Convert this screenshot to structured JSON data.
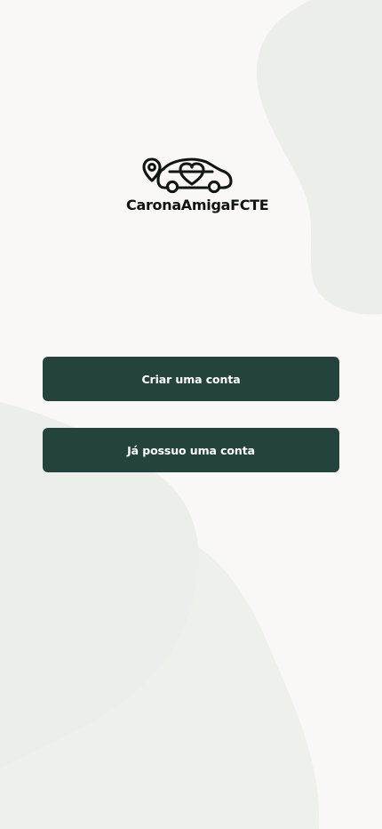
{
  "brand": {
    "name": "CaronaAmigaFCTE",
    "logo_icon": "car-location-heart-icon"
  },
  "actions": {
    "create_account_label": "Criar uma conta",
    "login_label": "Já possuo uma conta"
  },
  "colors": {
    "background": "#f9f8f6",
    "decorative_shape": "#eceeea",
    "button": "#24433c",
    "button_text": "#ffffff",
    "text": "#0f1413"
  }
}
